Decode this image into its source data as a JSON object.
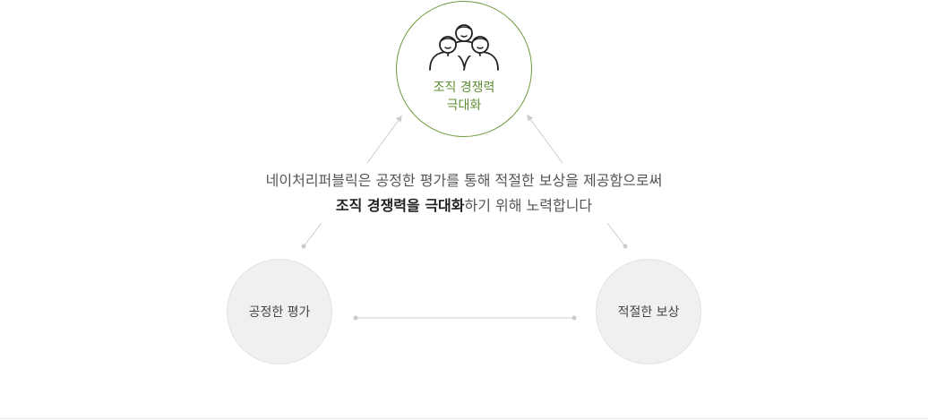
{
  "top_node": {
    "icon": "people-group-icon",
    "title_line1": "조직 경쟁력",
    "title_line2": "극대화",
    "color": "#6e9a3c"
  },
  "description": {
    "line1": "네이처리퍼블릭은 공정한 평가를 통해 적절한 보상을 제공함으로써",
    "line2_bold": "조직 경쟁력을 극대화",
    "line2_rest": "하기 위해 노력합니다"
  },
  "left_node": {
    "label": "공정한 평가"
  },
  "right_node": {
    "label": "적절한 보상"
  },
  "colors": {
    "connector": "#cccccc",
    "circle_fill": "#f0f0f0",
    "text": "#555555"
  }
}
